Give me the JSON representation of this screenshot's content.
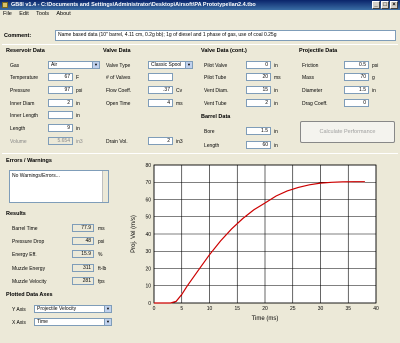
{
  "window": {
    "title": "GB8I v1.4 - C:\\Documents and Settings\\Administrator\\Desktop\\Airsoft\\PA Prototype\\Ian2.4.tbo",
    "minimize_glyph": "_",
    "maximize_glyph": "□",
    "close_glyph": "×"
  },
  "menu": {
    "items": [
      "File",
      "Edit",
      "Tools",
      "About"
    ]
  },
  "comment": {
    "label": "Comment:",
    "value": "Name based data (10\" barrel, 4.11 cm, 0.2g bb); 1g of diesel and 1 phase of gas, use of coal 0.25g"
  },
  "reservoir": {
    "title": "Reservoir Data",
    "gas": {
      "label": "Gas",
      "value": "Air"
    },
    "temperature": {
      "label": "Temperature",
      "value": "67",
      "unit": "F"
    },
    "pressure": {
      "label": "Pressure",
      "value": "97",
      "unit": "psi"
    },
    "inner_diam": {
      "label": "Inner Diam",
      "value": "2",
      "unit": "in"
    },
    "inner_length": {
      "label": "Inner Length",
      "value": "",
      "unit": "in"
    },
    "length": {
      "label": "Length",
      "value": "9",
      "unit": "in"
    },
    "volume": {
      "label": "Volume",
      "value": "5.654",
      "unit": "in3"
    }
  },
  "valve": {
    "title": "Valve Data",
    "valve_type": {
      "label": "Valve Type",
      "value": "Classic Spool"
    },
    "num_valves": {
      "label": "# of Valves",
      "value": ""
    },
    "flow_coeff": {
      "label": "Flow Coeff.",
      "value": ".37",
      "unit": "Cv"
    },
    "open_time": {
      "label": "Open Time",
      "value": "4",
      "unit": "ms"
    },
    "drain_vol": {
      "label": "Drain Vol.",
      "value": "2",
      "unit": "in3"
    }
  },
  "valve_cont": {
    "title": "Valve Data (cont.)",
    "pilot_valve": {
      "label": "Pilot Valve",
      "value": "0",
      "unit": "in"
    },
    "pilot_tube": {
      "label": "Pilot Tube",
      "value": "20",
      "unit": "ms"
    },
    "vent_diam": {
      "label": "Vent Diam.",
      "value": "15",
      "unit": "in"
    },
    "vent_tube": {
      "label": "Vent Tube",
      "value": "2",
      "unit": "in"
    }
  },
  "barrel": {
    "title": "Barrel Data",
    "bore": {
      "label": "Bore",
      "value": "1.5",
      "unit": "in"
    },
    "length": {
      "label": "Length",
      "value": "60",
      "unit": "in"
    }
  },
  "projectile": {
    "title": "Projectile Data",
    "friction": {
      "label": "Friction",
      "value": "0.5",
      "unit": "psi"
    },
    "mass": {
      "label": "Mass",
      "value": "70",
      "unit": "g"
    },
    "diameter": {
      "label": "Diameter",
      "value": "1.5",
      "unit": "in"
    },
    "drag_coeff": {
      "label": "Drag Coeff.",
      "value": "0",
      "unit": ""
    }
  },
  "calc_button": "Calculate Performance",
  "errors": {
    "title": "Errors / Warnings",
    "text": "No Warnings/Errors..."
  },
  "results": {
    "title": "Results",
    "barrel_time": {
      "label": "Barrel Time",
      "value": "77.9",
      "unit": "ms"
    },
    "pressure_drop": {
      "label": "Pressure Drop",
      "value": "48",
      "unit": "psi"
    },
    "energy_eff": {
      "label": "Energy Eff.",
      "value": "15.9",
      "unit": "%"
    },
    "muzzle_energy": {
      "label": "Muzzle Energy",
      "value": "311",
      "unit": "ft-lb"
    },
    "muzzle_velocity": {
      "label": "Muzzle Velocity",
      "value": "281",
      "unit": "fps"
    }
  },
  "plotted": {
    "title": "Plotted Data Axes",
    "y_axis": {
      "label": "Y Axis",
      "value": "Projectile Velocity"
    },
    "x_axis": {
      "label": "X Axis",
      "value": "Time"
    }
  },
  "chart_data": {
    "type": "line",
    "xlabel": "Time (ms)",
    "ylabel": "Proj. Vel (m/s)",
    "xlim": [
      0,
      40
    ],
    "ylim": [
      0,
      80
    ],
    "xticks": [
      "0",
      "5",
      "10",
      "15",
      "20",
      "25",
      "30",
      "35",
      "40"
    ],
    "yticks": [
      "0",
      "10",
      "20",
      "30",
      "40",
      "50",
      "60",
      "70",
      "80"
    ],
    "grid": true,
    "line_color": "#cc0000",
    "x": [
      0,
      3,
      4,
      5,
      6,
      8,
      10,
      12,
      14,
      16,
      18,
      20,
      22,
      24,
      26,
      28,
      30,
      32,
      34,
      36,
      38
    ],
    "y": [
      0,
      0,
      1,
      5,
      10,
      19,
      28,
      36,
      43,
      49,
      54,
      58,
      62,
      65,
      67,
      68.5,
      69.5,
      70,
      70.2,
      70.3,
      70.3
    ]
  }
}
